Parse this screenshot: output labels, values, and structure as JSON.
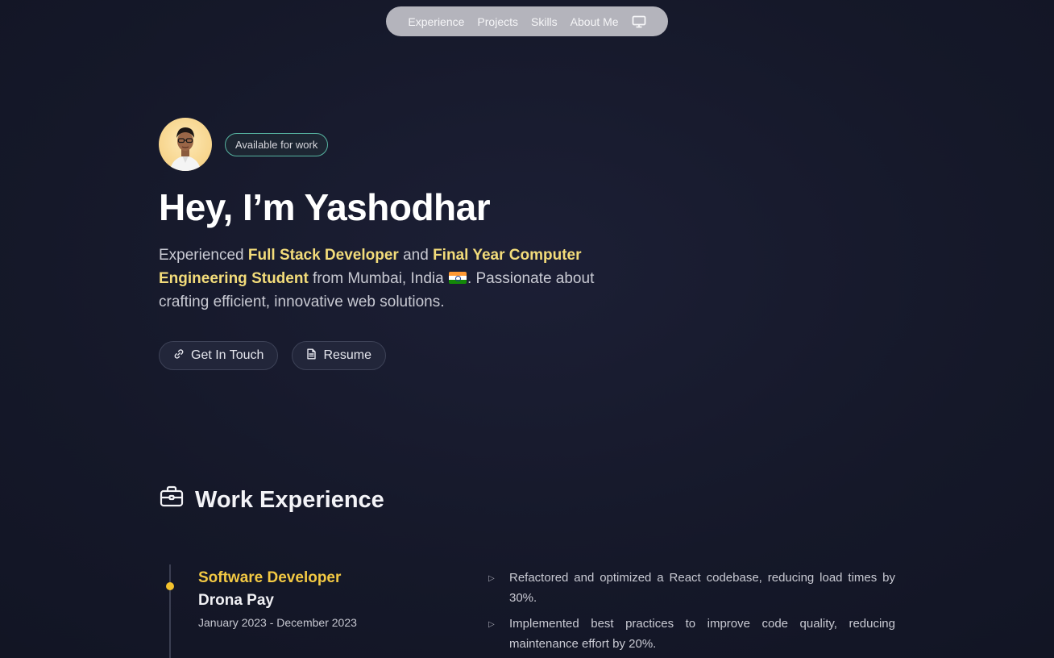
{
  "nav": {
    "items": [
      {
        "label": "Experience"
      },
      {
        "label": "Projects"
      },
      {
        "label": "Skills"
      },
      {
        "label": "About Me"
      }
    ],
    "theme_icon": "monitor-icon"
  },
  "hero": {
    "badge": "Available for work",
    "greeting": "Hey, I’m Yashodhar",
    "intro": {
      "p1": "Experienced ",
      "h1": "Full Stack Developer",
      "p2": " and ",
      "h2": "Final Year Computer Engineering Student",
      "p3": " from Mumbai, India ",
      "flag_icon": "india-flag-icon",
      "p4": ". Passionate about crafting efficient, innovative web solutions."
    },
    "buttons": {
      "contact": {
        "label": "Get In Touch",
        "icon": "link-icon"
      },
      "resume": {
        "label": "Resume",
        "icon": "document-icon"
      }
    }
  },
  "experience": {
    "title": "Work Experience",
    "icon": "briefcase-icon",
    "jobs": [
      {
        "role": "Software Developer",
        "company": "Drona Pay",
        "dates": "January 2023 - December 2023",
        "points": [
          "Refactored and optimized a React codebase, reducing load times by 30%.",
          "Implemented best practices to improve code quality, reducing maintenance effort by 20%."
        ]
      }
    ]
  },
  "colors": {
    "accent": "#f3c943",
    "highlight": "#f3dc7a",
    "badge_border": "#56b3a0",
    "background": "#151829"
  }
}
